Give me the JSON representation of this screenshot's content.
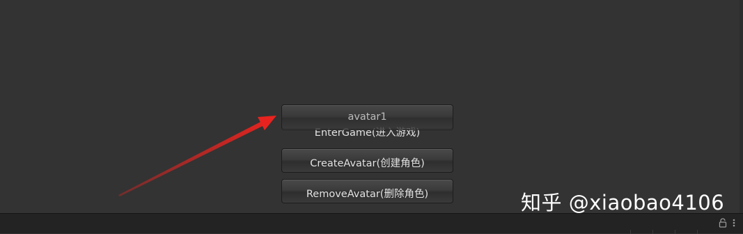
{
  "game_view": {
    "buttons": {
      "avatar_label": "avatar1",
      "enter_game_label": "EnterGame(进入游戏)",
      "create_avatar_label": "CreateAvatar(创建角色)",
      "remove_avatar_label": "RemoveAvatar(删除角色)"
    },
    "annotation": {
      "arrow_color": "#e8231f"
    }
  },
  "watermark": {
    "text": "知乎 @xiaobao4106"
  },
  "status_bar": {
    "icons": [
      "lock-icon",
      "context-menu-icon"
    ]
  },
  "colors": {
    "background": "#333333",
    "button_text": "#e2e2e2",
    "status_bar": "#232323"
  }
}
